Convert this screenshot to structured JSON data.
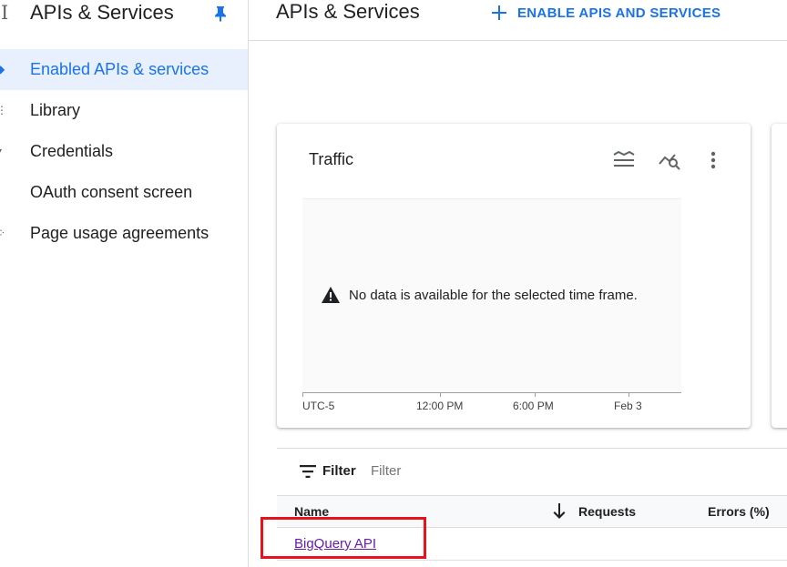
{
  "sidebar": {
    "title": "APIs & Services",
    "items": [
      {
        "label": "Enabled APIs & services",
        "icon": "dashboard-icon",
        "active": true
      },
      {
        "label": "Library",
        "icon": "library-icon"
      },
      {
        "label": "Credentials",
        "icon": "key-icon"
      },
      {
        "label": "OAuth consent screen",
        "icon": "consent-icon"
      },
      {
        "label": "Page usage agreements",
        "icon": "settings-icon"
      }
    ]
  },
  "header": {
    "title": "APIs & Services",
    "enable_button": "ENABLE APIS AND SERVICES"
  },
  "traffic_card": {
    "title": "Traffic",
    "no_data": "No data is available for the selected time frame.",
    "x_ticks": [
      "UTC-5",
      "12:00 PM",
      "6:00 PM",
      "Feb 3"
    ]
  },
  "filter": {
    "label": "Filter",
    "placeholder": "Filter"
  },
  "table": {
    "columns": {
      "name": "Name",
      "requests": "Requests",
      "errors": "Errors (%)"
    },
    "rows": [
      {
        "name": "BigQuery API"
      }
    ]
  },
  "colors": {
    "accent": "#1a73e8",
    "active_bg": "#e8f0fe",
    "link_visited": "#681da8",
    "highlight_box": "#e8121c"
  }
}
